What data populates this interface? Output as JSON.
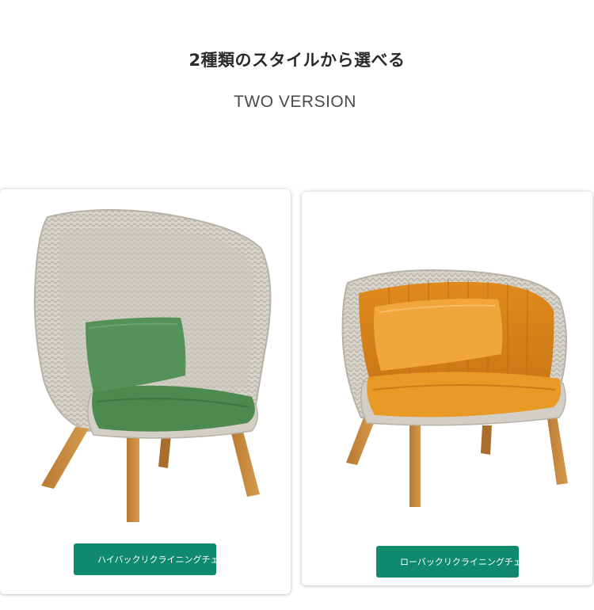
{
  "header": {
    "title_jp": "2種類のスタイルから選べる",
    "title_en": "TWO VERSION"
  },
  "products": [
    {
      "label": "ハイバックリクライニングチェア",
      "cushion_color": "#4d8a4f",
      "frame_color": "#cfcbc2",
      "leg_color": "#c9893c",
      "label_bg": "#0f8a6f"
    },
    {
      "label": "ローバックリクライニングチェア",
      "cushion_color": "#e89a26",
      "frame_color": "#cfcbc2",
      "leg_color": "#c9893c",
      "label_bg": "#0f8a6f"
    }
  ],
  "icons": [
    "high-back-chair-image",
    "low-back-chair-image"
  ]
}
